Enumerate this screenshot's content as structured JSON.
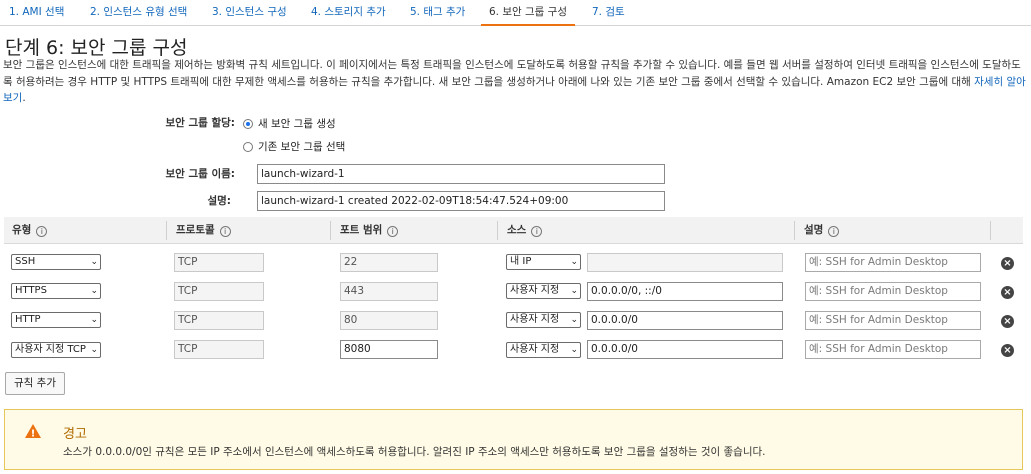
{
  "wizard": {
    "tabs": [
      {
        "label": "1. AMI 선택"
      },
      {
        "label": "2. 인스턴스 유형 선택"
      },
      {
        "label": "3. 인스턴스 구성"
      },
      {
        "label": "4. 스토리지 추가"
      },
      {
        "label": "5. 태그 추가"
      },
      {
        "label": "6. 보안 그룹 구성",
        "active": true
      },
      {
        "label": "7. 검토"
      }
    ],
    "accent_color": "#ec7211"
  },
  "header": {
    "step_label": "단계 6:",
    "title": "보안 그룹 구성",
    "description": "보안 그룹은 인스턴스에 대한 트래픽을 제어하는 방화벽 규칙 세트입니다. 이 페이지에서는 특정 트래픽을 인스턴스에 도달하도록 허용할 규칙을 추가할 수 있습니다. 예를 들면 웹 서버를 설정하여 인터넷 트래픽을 인스턴스에 도달하도록 허용하려는 경우 HTTP 및 HTTPS 트래픽에 대한 무제한 액세스를 허용하는 규칙을 추가합니다. 새 보안 그룹을 생성하거나 아래에 나와 있는 기존 보안 그룹 중에서 선택할 수 있습니다. Amazon EC2 보안 그룹에 대해",
    "learn_more_link": "자세히 알아보기",
    "description_end": "."
  },
  "form": {
    "assign_label": "보안 그룹 할당:",
    "option_new": "새 보안 그룹 생성",
    "option_existing": "기존 보안 그룹 선택",
    "name_label": "보안 그룹 이름:",
    "name_value": "launch-wizard-1",
    "description_label": "설명:",
    "description_value": "launch-wizard-1 created 2022-02-09T18:54:47.524+09:00"
  },
  "table": {
    "headers": {
      "type": "유형",
      "protocol": "프로토콜",
      "port_range": "포트 범위",
      "source": "소스",
      "description": "설명"
    },
    "info_glyph": "i",
    "remove_glyph": "×",
    "rows": [
      {
        "type": "SSH",
        "protocol": "TCP",
        "port": "22",
        "source_select": "내 IP",
        "source_value": "",
        "description_placeholder": "예: SSH for Admin Desktop"
      },
      {
        "type": "HTTPS",
        "protocol": "TCP",
        "port": "443",
        "source_select": "사용자 지정",
        "source_value": "0.0.0.0/0, ::/0",
        "description_placeholder": "예: SSH for Admin Desktop"
      },
      {
        "type": "HTTP",
        "protocol": "TCP",
        "port": "80",
        "source_select": "사용자 지정",
        "source_value": "0.0.0.0/0",
        "description_placeholder": "예: SSH for Admin Desktop"
      },
      {
        "type": "사용자 지정 TCP",
        "protocol": "TCP",
        "port": "8080",
        "source_select": "사용자 지정",
        "source_value": "0.0.0.0/0",
        "description_placeholder": "예: SSH for Admin Desktop"
      }
    ],
    "add_rule_label": "규칙 추가"
  },
  "warning": {
    "title": "경고",
    "message": "소스가 0.0.0.0/0인 규칙은 모든 IP 주소에서 인스턴스에 액세스하도록 허용합니다. 알려진 IP 주소의 액세스만 허용하도록 보안 그룹을 설정하는 것이 좋습니다.",
    "icon_glyph": "!",
    "border_color": "#e7c65c",
    "background_color": "#fffbe6",
    "icon_color": "#ec7211"
  }
}
